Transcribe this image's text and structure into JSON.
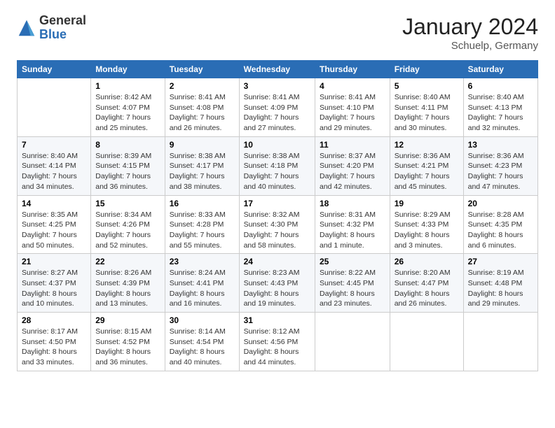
{
  "logo": {
    "general": "General",
    "blue": "Blue"
  },
  "title": "January 2024",
  "location": "Schuelp, Germany",
  "days_header": [
    "Sunday",
    "Monday",
    "Tuesday",
    "Wednesday",
    "Thursday",
    "Friday",
    "Saturday"
  ],
  "weeks": [
    [
      {
        "day": "",
        "info": ""
      },
      {
        "day": "1",
        "info": "Sunrise: 8:42 AM\nSunset: 4:07 PM\nDaylight: 7 hours\nand 25 minutes."
      },
      {
        "day": "2",
        "info": "Sunrise: 8:41 AM\nSunset: 4:08 PM\nDaylight: 7 hours\nand 26 minutes."
      },
      {
        "day": "3",
        "info": "Sunrise: 8:41 AM\nSunset: 4:09 PM\nDaylight: 7 hours\nand 27 minutes."
      },
      {
        "day": "4",
        "info": "Sunrise: 8:41 AM\nSunset: 4:10 PM\nDaylight: 7 hours\nand 29 minutes."
      },
      {
        "day": "5",
        "info": "Sunrise: 8:40 AM\nSunset: 4:11 PM\nDaylight: 7 hours\nand 30 minutes."
      },
      {
        "day": "6",
        "info": "Sunrise: 8:40 AM\nSunset: 4:13 PM\nDaylight: 7 hours\nand 32 minutes."
      }
    ],
    [
      {
        "day": "7",
        "info": "Sunrise: 8:40 AM\nSunset: 4:14 PM\nDaylight: 7 hours\nand 34 minutes."
      },
      {
        "day": "8",
        "info": "Sunrise: 8:39 AM\nSunset: 4:15 PM\nDaylight: 7 hours\nand 36 minutes."
      },
      {
        "day": "9",
        "info": "Sunrise: 8:38 AM\nSunset: 4:17 PM\nDaylight: 7 hours\nand 38 minutes."
      },
      {
        "day": "10",
        "info": "Sunrise: 8:38 AM\nSunset: 4:18 PM\nDaylight: 7 hours\nand 40 minutes."
      },
      {
        "day": "11",
        "info": "Sunrise: 8:37 AM\nSunset: 4:20 PM\nDaylight: 7 hours\nand 42 minutes."
      },
      {
        "day": "12",
        "info": "Sunrise: 8:36 AM\nSunset: 4:21 PM\nDaylight: 7 hours\nand 45 minutes."
      },
      {
        "day": "13",
        "info": "Sunrise: 8:36 AM\nSunset: 4:23 PM\nDaylight: 7 hours\nand 47 minutes."
      }
    ],
    [
      {
        "day": "14",
        "info": "Sunrise: 8:35 AM\nSunset: 4:25 PM\nDaylight: 7 hours\nand 50 minutes."
      },
      {
        "day": "15",
        "info": "Sunrise: 8:34 AM\nSunset: 4:26 PM\nDaylight: 7 hours\nand 52 minutes."
      },
      {
        "day": "16",
        "info": "Sunrise: 8:33 AM\nSunset: 4:28 PM\nDaylight: 7 hours\nand 55 minutes."
      },
      {
        "day": "17",
        "info": "Sunrise: 8:32 AM\nSunset: 4:30 PM\nDaylight: 7 hours\nand 58 minutes."
      },
      {
        "day": "18",
        "info": "Sunrise: 8:31 AM\nSunset: 4:32 PM\nDaylight: 8 hours\nand 1 minute."
      },
      {
        "day": "19",
        "info": "Sunrise: 8:29 AM\nSunset: 4:33 PM\nDaylight: 8 hours\nand 3 minutes."
      },
      {
        "day": "20",
        "info": "Sunrise: 8:28 AM\nSunset: 4:35 PM\nDaylight: 8 hours\nand 6 minutes."
      }
    ],
    [
      {
        "day": "21",
        "info": "Sunrise: 8:27 AM\nSunset: 4:37 PM\nDaylight: 8 hours\nand 10 minutes."
      },
      {
        "day": "22",
        "info": "Sunrise: 8:26 AM\nSunset: 4:39 PM\nDaylight: 8 hours\nand 13 minutes."
      },
      {
        "day": "23",
        "info": "Sunrise: 8:24 AM\nSunset: 4:41 PM\nDaylight: 8 hours\nand 16 minutes."
      },
      {
        "day": "24",
        "info": "Sunrise: 8:23 AM\nSunset: 4:43 PM\nDaylight: 8 hours\nand 19 minutes."
      },
      {
        "day": "25",
        "info": "Sunrise: 8:22 AM\nSunset: 4:45 PM\nDaylight: 8 hours\nand 23 minutes."
      },
      {
        "day": "26",
        "info": "Sunrise: 8:20 AM\nSunset: 4:47 PM\nDaylight: 8 hours\nand 26 minutes."
      },
      {
        "day": "27",
        "info": "Sunrise: 8:19 AM\nSunset: 4:48 PM\nDaylight: 8 hours\nand 29 minutes."
      }
    ],
    [
      {
        "day": "28",
        "info": "Sunrise: 8:17 AM\nSunset: 4:50 PM\nDaylight: 8 hours\nand 33 minutes."
      },
      {
        "day": "29",
        "info": "Sunrise: 8:15 AM\nSunset: 4:52 PM\nDaylight: 8 hours\nand 36 minutes."
      },
      {
        "day": "30",
        "info": "Sunrise: 8:14 AM\nSunset: 4:54 PM\nDaylight: 8 hours\nand 40 minutes."
      },
      {
        "day": "31",
        "info": "Sunrise: 8:12 AM\nSunset: 4:56 PM\nDaylight: 8 hours\nand 44 minutes."
      },
      {
        "day": "",
        "info": ""
      },
      {
        "day": "",
        "info": ""
      },
      {
        "day": "",
        "info": ""
      }
    ]
  ]
}
